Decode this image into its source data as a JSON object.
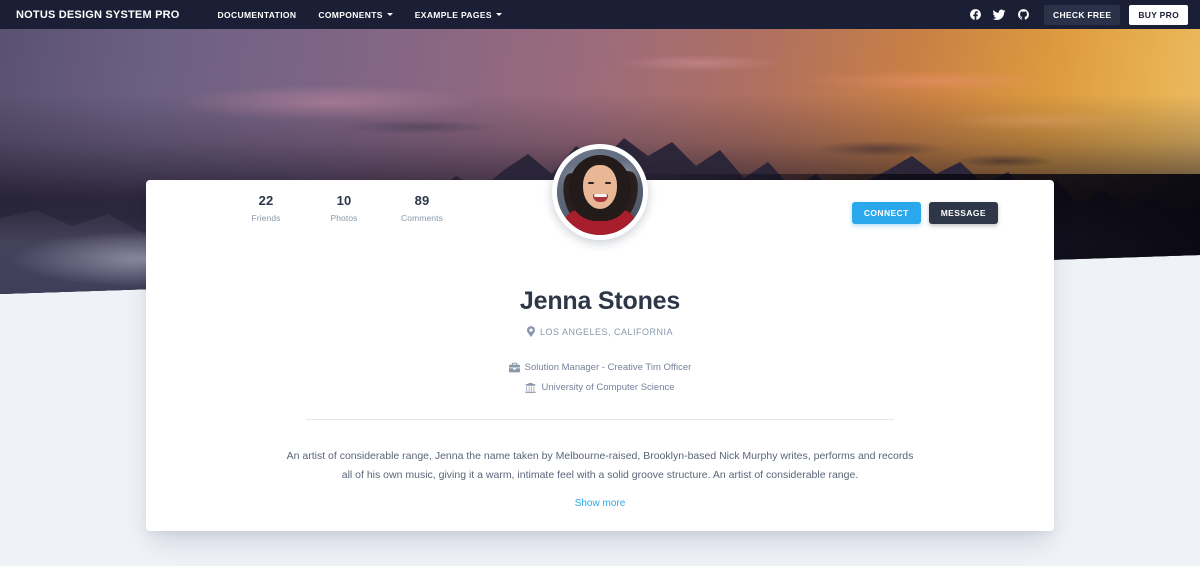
{
  "navbar": {
    "brand": "NOTUS DESIGN SYSTEM PRO",
    "links": [
      {
        "label": "DOCUMENTATION",
        "caret": false
      },
      {
        "label": "COMPONENTS",
        "caret": true
      },
      {
        "label": "EXAMPLE PAGES",
        "caret": true
      }
    ],
    "social": [
      {
        "name": "facebook-icon"
      },
      {
        "name": "twitter-icon"
      },
      {
        "name": "github-icon"
      }
    ],
    "check_free_label": "CHECK FREE",
    "buy_pro_label": "BUY PRO",
    "background_color": "#1b1f35"
  },
  "hero": {
    "alt": "snow-covered mountain range at dusk with purple and orange sunset sky"
  },
  "profile": {
    "avatar_alt": "smiling woman with dark wavy hair wearing a red top",
    "stats": [
      {
        "value": "22",
        "label": "Friends"
      },
      {
        "value": "10",
        "label": "Photos"
      },
      {
        "value": "89",
        "label": "Comments"
      }
    ],
    "actions": {
      "connect_label": "CONNECT",
      "connect_color": "#2ba8eb",
      "message_label": "MESSAGE",
      "message_color": "#2d3748"
    },
    "name": "Jenna Stones",
    "location": "LOS ANGELES, CALIFORNIA",
    "location_icon": "map-pin-icon",
    "job": "Solution Manager - Creative Tim Officer",
    "job_icon": "briefcase-icon",
    "education": "University of Computer Science",
    "education_icon": "university-icon",
    "bio": "An artist of considerable range, Jenna the name taken by Melbourne-raised, Brooklyn-based Nick Murphy writes, performs and records all of his own music, giving it a warm, intimate feel with a solid groove structure. An artist of considerable range.",
    "show_more_label": "Show more",
    "link_color": "#2ba8eb"
  },
  "page": {
    "background_color": "#eff2f7"
  }
}
